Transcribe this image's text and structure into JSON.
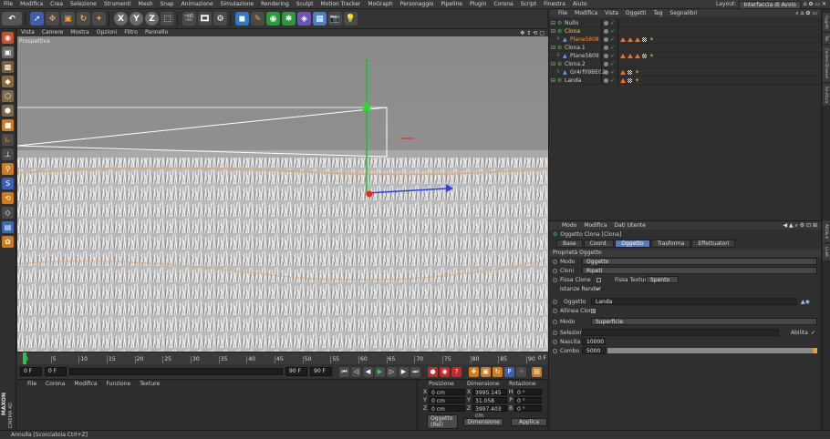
{
  "menubar": {
    "items": [
      "File",
      "Modifica",
      "Crea",
      "Selezione",
      "Strumenti",
      "Mesh",
      "Snap",
      "Animazione",
      "Simulazione",
      "Rendering",
      "Sculpt",
      "Motion Tracker",
      "MoGraph",
      "Personaggio",
      "Pipeline",
      "Plugin",
      "Corona",
      "Script",
      "Finestra",
      "Aiuto"
    ],
    "layout_label": "Layout:",
    "layout_value": "Interfaccia di Avvio"
  },
  "toolbar": {
    "axis_x": "X",
    "axis_y": "Y",
    "axis_z": "Z"
  },
  "viewport": {
    "menu": [
      "Vista",
      "Camere",
      "Mostra",
      "Opzioni",
      "Filtro",
      "Pannello"
    ],
    "label": "Prospettiva"
  },
  "timeline": {
    "ticks": [
      "0",
      "5",
      "10",
      "15",
      "20",
      "25",
      "30",
      "35",
      "40",
      "45",
      "50",
      "55",
      "60",
      "65",
      "70",
      "75",
      "80",
      "85",
      "90"
    ],
    "end_frame": "0 F"
  },
  "playbar": {
    "current_frame": "0 F",
    "start_field": "0 F",
    "end_field": "90 F",
    "max_field": "90 F"
  },
  "materials": {
    "menu": [
      "File",
      "Corona",
      "Modifica",
      "Funzione",
      "Texture"
    ]
  },
  "coordinates": {
    "headers": [
      "Posizione",
      "Dimensione",
      "Rotazione"
    ],
    "rows": [
      {
        "axis": "X",
        "pos": "0 cm",
        "size": "3995.145 cm",
        "rot_label": "H",
        "rot": "0 °"
      },
      {
        "axis": "Y",
        "pos": "0 cm",
        "size": "31.058 cm",
        "rot_label": "P",
        "rot": "0 °"
      },
      {
        "axis": "Z",
        "pos": "0 cm",
        "size": "3997.403 cm",
        "rot_label": "B",
        "rot": "0 °"
      }
    ],
    "mode_select": "Oggetto (Rel)",
    "size_select": "Dimensione",
    "apply_button": "Applica"
  },
  "object_manager": {
    "menu": [
      "File",
      "Modifica",
      "Vista",
      "Oggetti",
      "Tag",
      "Segnalibri"
    ],
    "objects": [
      {
        "name": "Nullo",
        "indent": 0,
        "color": "#cfcfcf",
        "tags": 0
      },
      {
        "name": "Clona",
        "indent": 0,
        "color": "#ffd21a",
        "tags": 0
      },
      {
        "name": "Plane5808",
        "indent": 1,
        "color": "#ff8c2a",
        "tags": 3
      },
      {
        "name": "Clona.1",
        "indent": 0,
        "color": "#cfcfcf",
        "tags": 0
      },
      {
        "name": "Plane5809",
        "indent": 1,
        "color": "#cfcfcf",
        "tags": 3
      },
      {
        "name": "Clona.2",
        "indent": 0,
        "color": "#cfcfcf",
        "tags": 0
      },
      {
        "name": "Gr4rf09BE02",
        "indent": 1,
        "color": "#cfcfcf",
        "tags": 1
      },
      {
        "name": "Landa",
        "indent": 0,
        "color": "#cfcfcf",
        "tags": 1
      }
    ]
  },
  "attributes": {
    "menu": [
      "Modo",
      "Modifica",
      "Dati Utente"
    ],
    "title": "Oggetto Clona [Clona]",
    "tabs": [
      "Base",
      "Coord.",
      "Oggetto",
      "Trasforma",
      "Effettuatori"
    ],
    "active_tab": "Oggetto",
    "section": "Proprietà Oggetto",
    "mode_label": "Modo",
    "mode_value": "Oggetto",
    "clones_label": "Cloni",
    "clones_value": "Ripeti",
    "fix_clone_label": "Fissa Clone",
    "fix_texture_label": "Fissa Texture",
    "fix_texture_value": "Spento",
    "instance_render_label": "Istanze Render",
    "object_label": "Oggetto",
    "object_value": "Landa",
    "align_clone_label": "Allinea Clone",
    "distribution_label": "Modo",
    "distribution_value": "Superficie",
    "selection_label": "Selezione",
    "enable_label": "Abilita",
    "count_label": "Nascita",
    "count_value": "10000",
    "seed_label": "Combo",
    "seed_value": "5000"
  },
  "status": {
    "text": "Annulla [Scorciatoia Ctrl+Z]"
  },
  "branding": {
    "maxon": "MAXON",
    "product": "CINEMA 4D"
  },
  "right_tabs": [
    "Oggetti",
    "Tak",
    "Content Browser",
    "Struttura",
    "Attributi",
    "Livelli"
  ]
}
